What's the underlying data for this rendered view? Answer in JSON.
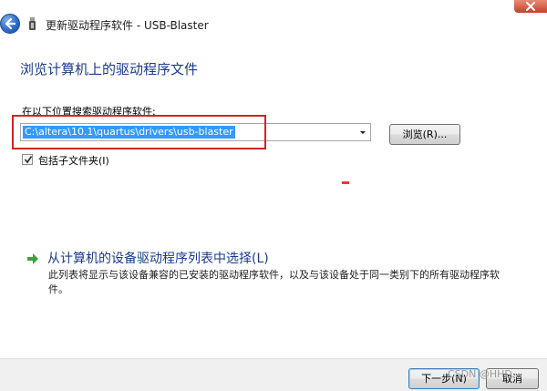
{
  "window": {
    "title": "更新驱动程序软件 - USB-Blaster",
    "back_icon": "back-arrow-icon",
    "close_icon": "close-icon"
  },
  "main": {
    "heading": "浏览计算机上的驱动程序文件",
    "search_label": "在以下位置搜索驱动程序软件:",
    "path_value": "C:\\altera\\10.1\\quartus\\drivers\\usb-blaster",
    "browse_label": "浏览(R)...",
    "include_subfolders_label": "包括子文件夹(I)",
    "include_subfolders_checked": true,
    "pick_from_list": {
      "title": "从计算机的设备驱动程序列表中选择(L)",
      "description": "此列表将显示与该设备兼容的已安装的驱动程序软件，以及与该设备处于同一类别下的所有驱动程序软件。"
    }
  },
  "footer": {
    "next_label": "下一步(N)",
    "cancel_label": "取消",
    "watermark": "CSDN @HHD..."
  },
  "colors": {
    "heading": "#1a3a8c",
    "selection": "#3399ff",
    "highlight_box": "#d42222",
    "link_arrow": "#3aa33a"
  }
}
